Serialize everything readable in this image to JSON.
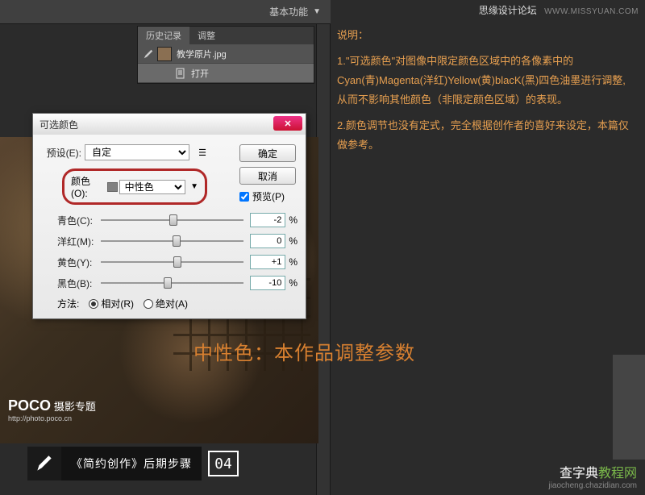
{
  "topbar": {
    "workspace_label": "基本功能"
  },
  "history_panel": {
    "tab_history": "历史记录",
    "tab_adjust": "调整",
    "file_name": "教学原片.jpg",
    "open_label": "打开"
  },
  "dialog": {
    "title": "可选颜色",
    "preset_label": "预设(E):",
    "preset_value": "自定",
    "ok": "确定",
    "cancel": "取消",
    "preview": "预览(P)",
    "color_label": "颜色(O):",
    "color_value": "中性色",
    "cyan_label": "青色(C):",
    "cyan_value": "-2",
    "magenta_label": "洋红(M):",
    "magenta_value": "0",
    "yellow_label": "黄色(Y):",
    "yellow_value": "+1",
    "black_label": "黑色(B):",
    "black_value": "-10",
    "method_label": "方法:",
    "method_relative": "相对(R)",
    "method_absolute": "绝对(A)",
    "pct": "%"
  },
  "watermark": {
    "site": "思缘设计论坛",
    "url": "WWW.MISSYUAN.COM"
  },
  "explain": {
    "title": "说明：",
    "p1": "1.\"可选颜色\"对图像中限定颜色区域中的各像素中的Cyan(青)Magenta(洋红)Yellow(黄)blacK(黑)四色油墨进行调整,从而不影响其他颜色（非限定颜色区域）的表现。",
    "p2": "2.颜色调节也没有定式，完全根据创作者的喜好来设定，本篇仅做参考。"
  },
  "big_label": "中性色：本作品调整参数",
  "poco": {
    "brand": "POCO 摄影专题",
    "url": "http://photo.poco.cn"
  },
  "step": {
    "title": "《简约创作》后期步骤",
    "num": "04"
  },
  "bottom_brand": {
    "name_pre": "查字典",
    "name_accent": "教程网",
    "url": "jiaocheng.chazidian.com"
  }
}
